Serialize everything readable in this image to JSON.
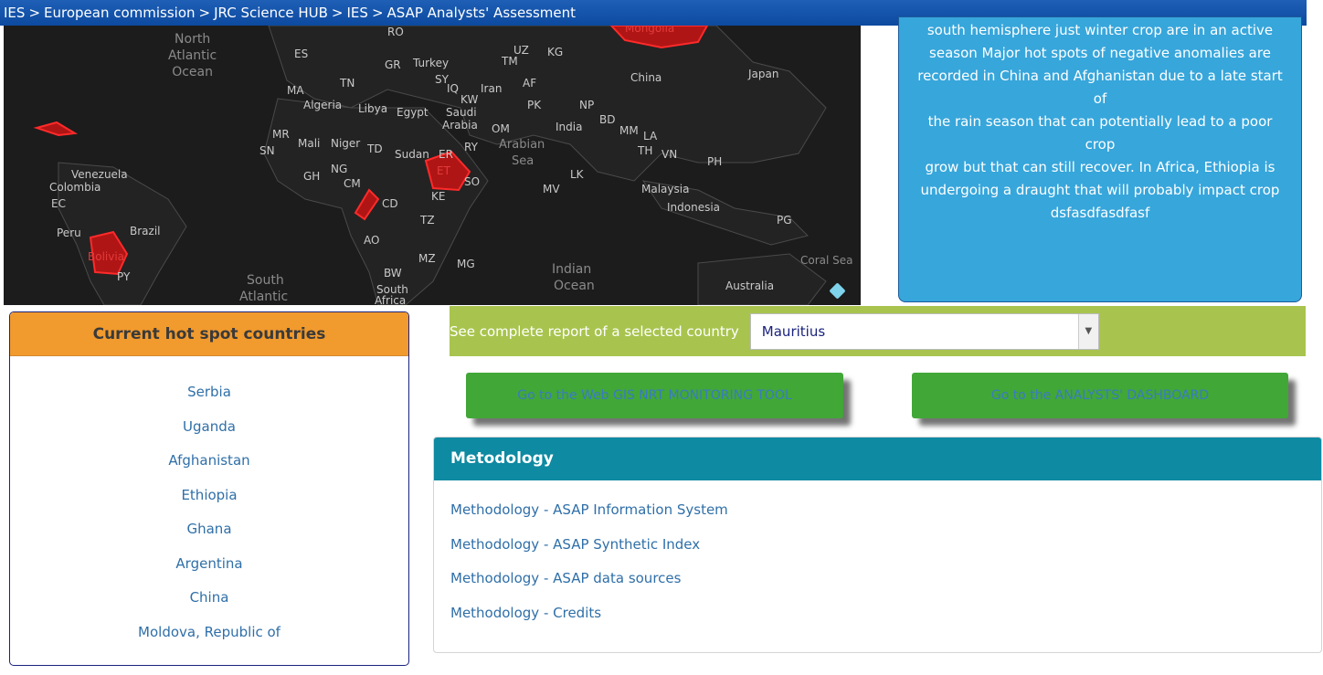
{
  "breadcrumb": {
    "items": [
      "IES",
      "European commission",
      "JRC Science HUB",
      "IES",
      "ASAP Analysts' Assessment"
    ],
    "separator": ">"
  },
  "map": {
    "labels": [
      "North",
      "Atlantic",
      "Ocean",
      "Mongolia",
      "Turkey",
      "GR",
      "RO",
      "UZ",
      "KG",
      "TM",
      "ES",
      "MA",
      "TN",
      "Algeria",
      "Libya",
      "Egypt",
      "SY",
      "IQ",
      "Iran",
      "KW",
      "AF",
      "PK",
      "NP",
      "China",
      "Japan",
      "India",
      "BD",
      "MM",
      "LA",
      "TH",
      "VN",
      "PH",
      "Saudi",
      "Arabia",
      "OM",
      "RY",
      "Arabian",
      "Sea",
      "MR",
      "Mali",
      "Niger",
      "SN",
      "TD",
      "Sudan",
      "ER",
      "ET",
      "SO",
      "KE",
      "LK",
      "MV",
      "Malaysia",
      "Indonesia",
      "PG",
      "GH",
      "NG",
      "CM",
      "CD",
      "TZ",
      "AO",
      "MG",
      "MZ",
      "BW",
      "South",
      "Africa",
      "Venezuela",
      "Colombia",
      "EC",
      "Peru",
      "Brazil",
      "Bolivia",
      "PY",
      "Indian",
      "Ocean",
      "Australia",
      "Coral Sea"
    ],
    "hotspot_color": "#e02020"
  },
  "summary": {
    "lines": [
      "south hemisphere just winter crop are in an active",
      "season Major hot spots of negative anomalies are",
      "recorded in China and Afghanistan due to a late start of",
      "the rain season that can potentially lead to a poor crop",
      "grow but that can still recover. In Africa, Ethiopia is",
      "undergoing a draught that will probably impact crop",
      "dsfasdfasdfasf"
    ]
  },
  "hotspots": {
    "title": "Current hot spot countries",
    "countries": [
      "Serbia",
      "Uganda",
      "Afghanistan",
      "Ethiopia",
      "Ghana",
      "Argentina",
      "China",
      "Moldova, Republic of"
    ]
  },
  "selector": {
    "label": "See complete report of a selected country",
    "selected": "Mauritius"
  },
  "buttons": {
    "gis": "Go to the Web GIS NRT MONITORING TOOL",
    "dashboard": "Go to the ANALYSTS' DASHBOARD"
  },
  "methodology": {
    "title": "Metodology",
    "links": [
      "Methodology - ASAP Information System",
      "Methodology - ASAP Synthetic Index",
      "Methodology - ASAP data sources",
      "Methodology - Credits"
    ]
  },
  "colors": {
    "breadcrumb": "#0c4aa0",
    "summary_bg": "#37a6db",
    "hotspot_header": "#f19a2d",
    "selector_bg": "#a8c44e",
    "button_bg": "#41a737",
    "methodology_header": "#0e8aa2"
  }
}
